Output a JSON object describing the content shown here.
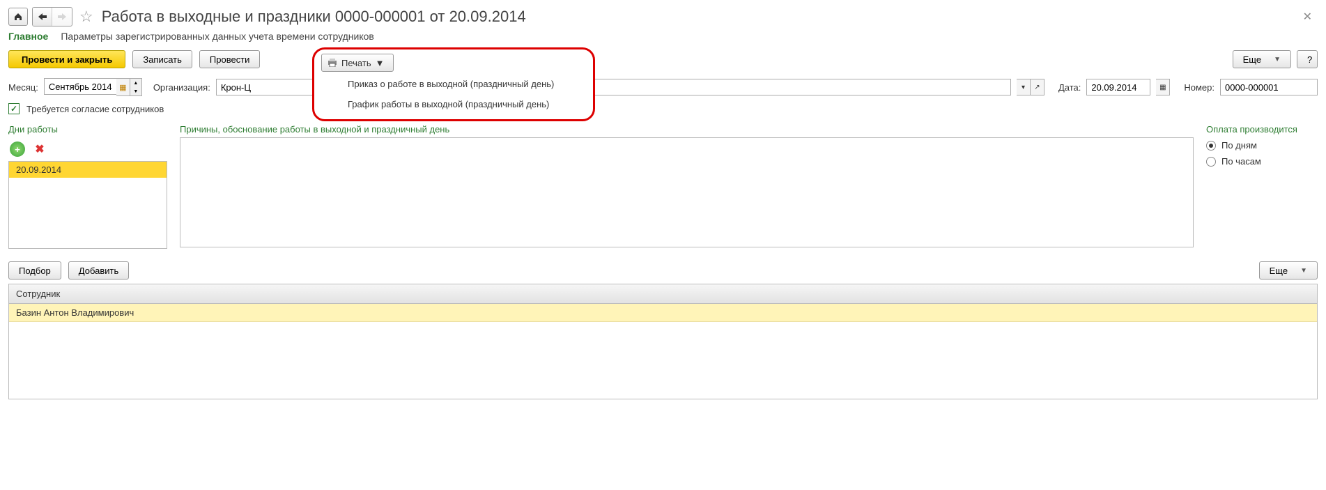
{
  "title": "Работа в выходные и праздники 0000-000001 от 20.09.2014",
  "tabs": {
    "main": "Главное",
    "params": "Параметры зарегистрированных данных учета времени сотрудников"
  },
  "toolbar": {
    "post_close": "Провести и закрыть",
    "save": "Записать",
    "post": "Провести",
    "print": "Печать",
    "more": "Еще"
  },
  "print_menu": {
    "item1": "Приказ о работе в выходной (праздничный день)",
    "item2": "График работы в выходной (праздничный день)"
  },
  "form": {
    "month_label": "Месяц:",
    "month_value": "Сентябрь 2014",
    "org_label": "Организация:",
    "org_value": "Крон-Ц",
    "date_label": "Дата:",
    "date_value": "20.09.2014",
    "num_label": "Номер:",
    "num_value": "0000-000001",
    "consent": "Требуется согласие сотрудников"
  },
  "sections": {
    "days": "Дни работы",
    "reason": "Причины, обоснование работы в выходной и праздничный день",
    "payment": "Оплата производится",
    "by_days": "По дням",
    "by_hours": "По часам"
  },
  "days_list": [
    "20.09.2014"
  ],
  "emp_toolbar": {
    "select": "Подбор",
    "add": "Добавить",
    "more": "Еще"
  },
  "table": {
    "header": "Сотрудник",
    "rows": [
      "Базин Антон Владимирович"
    ]
  }
}
